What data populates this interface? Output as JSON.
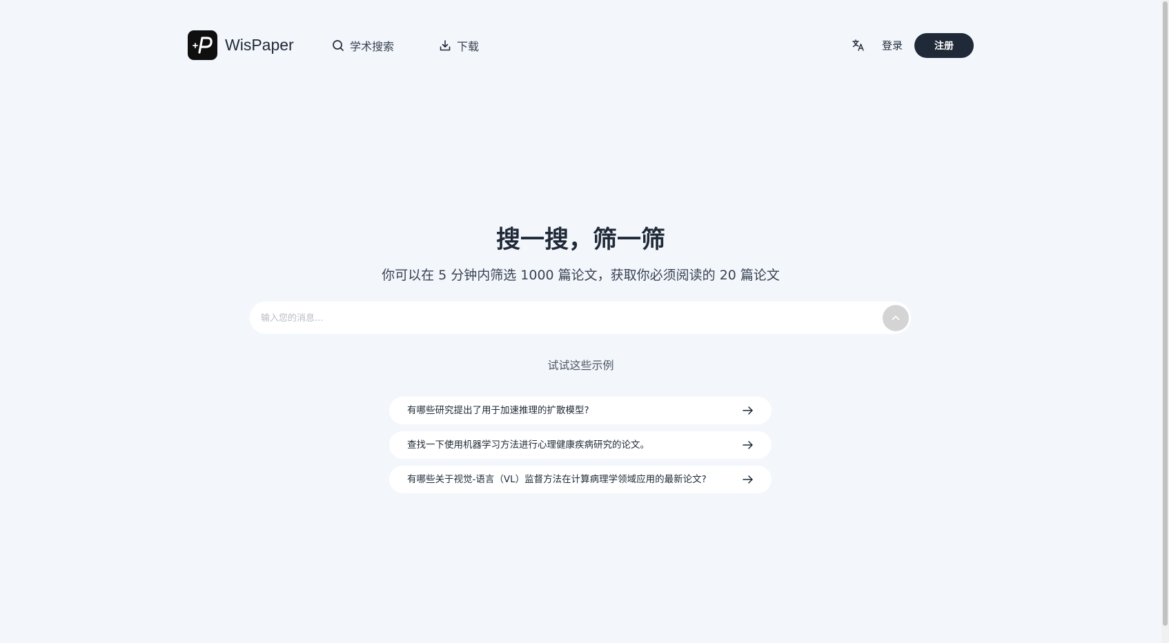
{
  "header": {
    "brand": "WisPaper",
    "nav": [
      {
        "label": "学术搜索",
        "icon": "search-icon"
      },
      {
        "label": "下载",
        "icon": "download-icon"
      }
    ],
    "translate_icon": "translate-icon",
    "login_label": "登录",
    "register_label": "注册"
  },
  "hero": {
    "title": "搜一搜，筛一筛",
    "subtitle": "你可以在 5 分钟内筛选 1000 篇论文，获取你必须阅读的 20 篇论文"
  },
  "search": {
    "placeholder": "输入您的消息...",
    "value": ""
  },
  "examples": {
    "label": "试试这些示例",
    "items": [
      {
        "text": "有哪些研究提出了用于加速推理的扩散模型?"
      },
      {
        "text": "查找一下使用机器学习方法进行心理健康疾病研究的论文。"
      },
      {
        "text": "有哪些关于视觉-语言（VL）监督方法在计算病理学领域应用的最新论文?"
      }
    ]
  },
  "colors": {
    "background": "#f3f7fc",
    "accent_dark": "#1f2937",
    "send_button": "#d4d4d4"
  }
}
